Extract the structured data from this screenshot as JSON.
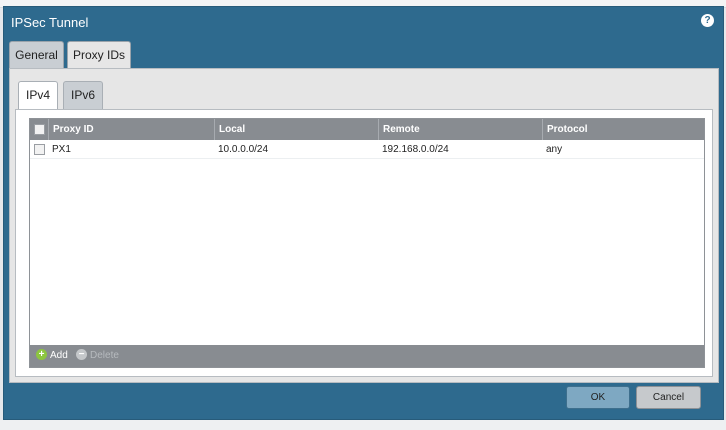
{
  "dialog": {
    "title": "IPSec Tunnel",
    "help_icon": "help-icon",
    "help_glyph": "?"
  },
  "outer_tabs": [
    {
      "label": "General",
      "active": false
    },
    {
      "label": "Proxy IDs",
      "active": true
    }
  ],
  "inner_tabs": [
    {
      "label": "IPv4",
      "active": true
    },
    {
      "label": "IPv6",
      "active": false
    }
  ],
  "table": {
    "columns": [
      "Proxy ID",
      "Local",
      "Remote",
      "Protocol"
    ],
    "rows": [
      {
        "proxy_id": "PX1",
        "local": "10.0.0.0/24",
        "remote": "192.168.0.0/24",
        "protocol": "any",
        "checked": false
      }
    ]
  },
  "toolbar": {
    "add_label": "Add",
    "add_glyph": "+",
    "delete_label": "Delete",
    "delete_glyph": "−"
  },
  "footer": {
    "ok_label": "OK",
    "cancel_label": "Cancel"
  },
  "colors": {
    "dialog_blue": "#2e6a8e",
    "header_gray": "#888c91",
    "add_green": "#8cc63f"
  }
}
